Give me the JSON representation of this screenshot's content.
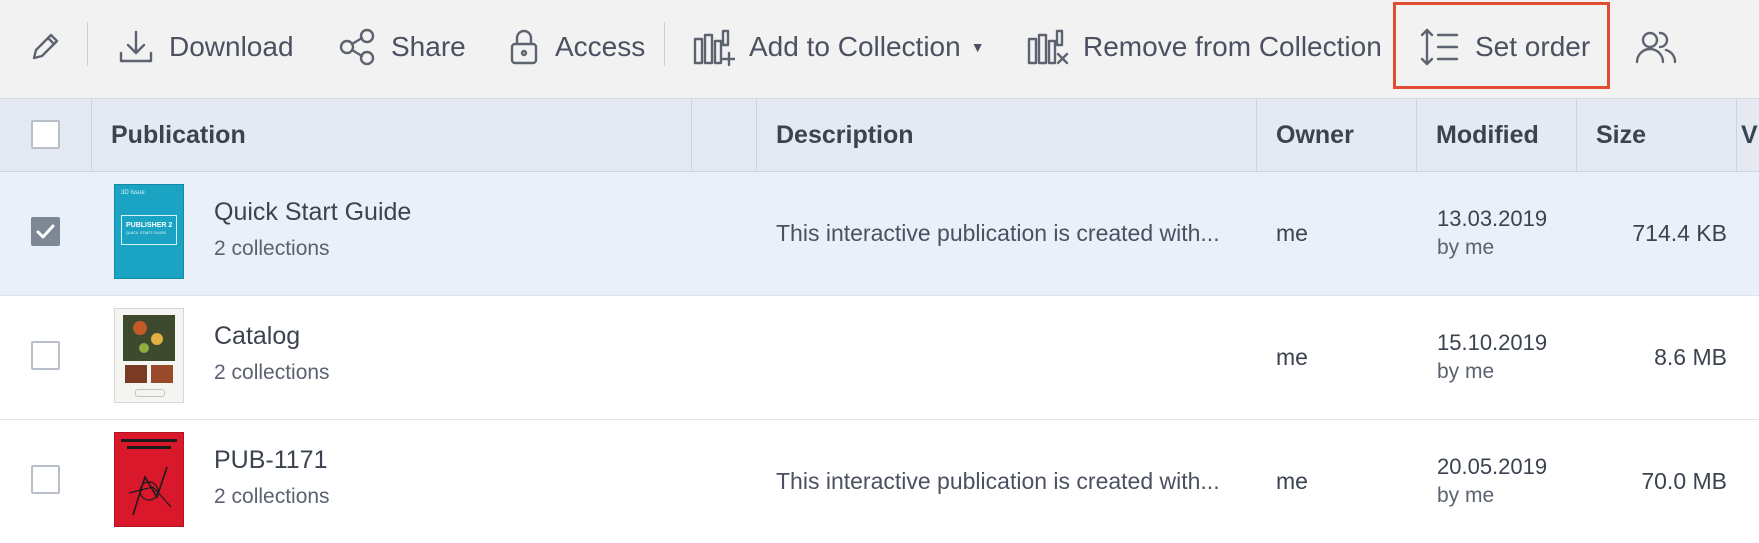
{
  "toolbar": {
    "edit_icon": "pencil-icon",
    "download_label": "Download",
    "share_label": "Share",
    "access_label": "Access",
    "add_to_collection_label": "Add to Collection",
    "remove_from_collection_label": "Remove from Collection",
    "set_order_label": "Set order",
    "users_icon": "users-icon"
  },
  "table": {
    "columns": [
      "Publication",
      "",
      "Description",
      "Owner",
      "Modified",
      "Size",
      "V"
    ],
    "rows": [
      {
        "title": "Quick Start Guide",
        "collections": "2 collections",
        "description": "This interactive publication is created with...",
        "owner": "me",
        "modified_date": "13.03.2019",
        "modified_by": "by me",
        "size": "714.4 KB",
        "checked": true,
        "thumb_text": "PUBLISHER 2",
        "thumb_subtext": "QUICK START GUIDE",
        "thumb_brand": "3D Issue"
      },
      {
        "title": "Catalog",
        "collections": "2 collections",
        "description": "",
        "owner": "me",
        "modified_date": "15.10.2019",
        "modified_by": "by me",
        "size": "8.6 MB",
        "checked": false
      },
      {
        "title": "PUB-1171",
        "collections": "2 collections",
        "description": "This interactive publication is created with...",
        "owner": "me",
        "modified_date": "20.05.2019",
        "modified_by": "by me",
        "size": "70.0 MB",
        "checked": false
      }
    ]
  },
  "colors": {
    "toolbar_bg": "#f2f2f2",
    "header_bg": "#e5eaf2",
    "selected_row_bg": "#eaf0f9",
    "highlight_border": "#e24d32",
    "thumb_teal": "#1aa3c2",
    "thumb_red": "#d9182b"
  }
}
